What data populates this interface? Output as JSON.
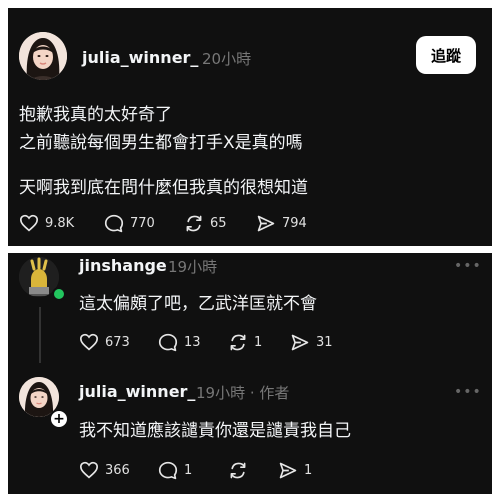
{
  "post": {
    "username": "julia_winner_",
    "time": "20小時",
    "follow_label": "追蹤",
    "lines": [
      "抱歉我真的太好奇了",
      "之前聽說每個男生都會打手X是真的嗎",
      "天啊我到底在問什麼但我真的很想知道"
    ],
    "likes": "9.8K",
    "comments": "770",
    "reposts": "65",
    "shares": "794"
  },
  "replies": [
    {
      "username": "jinshange",
      "time": "19小時",
      "text": "這太偏頗了吧，乙武洋匡就不會",
      "likes": "673",
      "comments": "13",
      "reposts": "1",
      "shares": "31",
      "more": "•••"
    },
    {
      "username": "julia_winner_",
      "time": "19小時 · 作者",
      "text": "我不知道應該譴責你還是譴責我自己",
      "likes": "366",
      "comments": "1",
      "reposts": "",
      "shares": "1",
      "more": "•••"
    }
  ],
  "colors": {
    "background": "#101010",
    "text": "#f3f5f7",
    "muted": "#777777",
    "online": "#22c55e"
  }
}
